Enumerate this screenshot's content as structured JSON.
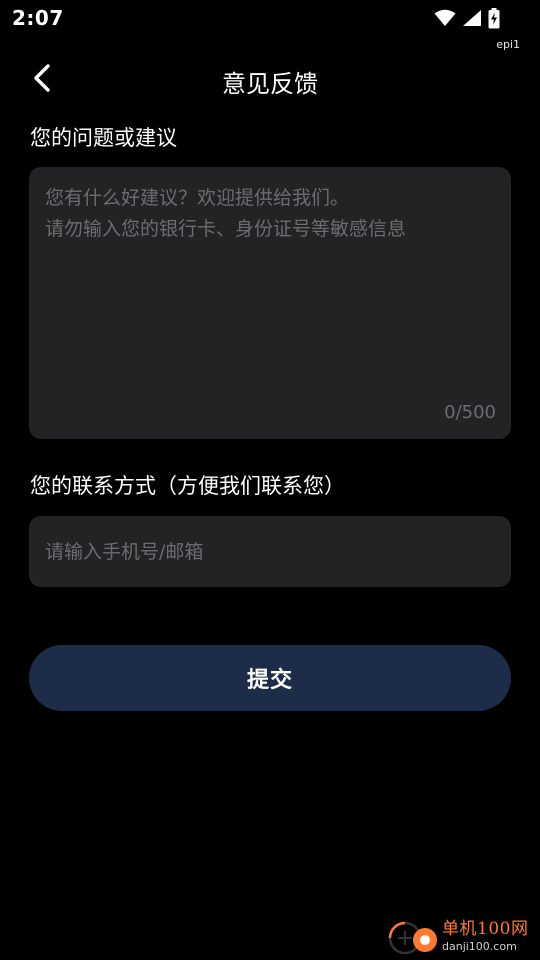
{
  "status_bar": {
    "time": "2:07",
    "tag": "epi1",
    "icons": [
      "wifi-icon",
      "signal-icon",
      "battery-charging-icon"
    ]
  },
  "header": {
    "title": "意见反馈",
    "back_icon": "chevron-left-icon"
  },
  "feedback": {
    "label": "您的问题或建议",
    "value": "",
    "placeholder": "您有什么好建议？欢迎提供给我们。\n请勿输入您的银行卡、身份证号等敏感信息",
    "counter": "0/500"
  },
  "contact": {
    "label": "您的联系方式（方便我们联系您）",
    "value": "",
    "placeholder": "请输入手机号/邮箱"
  },
  "submit": {
    "label": "提交"
  },
  "watermark": {
    "name_cn": "单机100网",
    "domain": "danji100.com"
  },
  "colors": {
    "background": "#000000",
    "field_background": "#232325",
    "placeholder": "#6c6c70",
    "button": "#1d2c49",
    "text": "#ffffff",
    "watermark_accent": "#ff7a2e"
  }
}
